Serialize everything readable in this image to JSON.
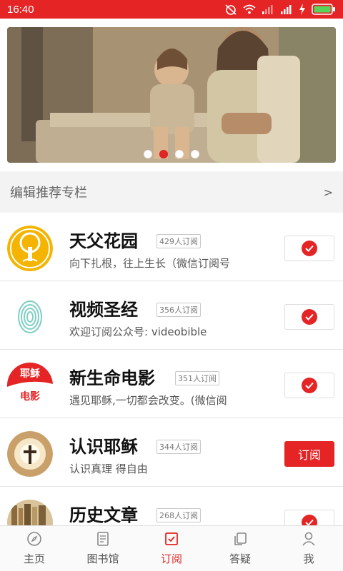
{
  "status_bar": {
    "time": "16:40",
    "icons": [
      "alarm-off-icon",
      "wifi-icon",
      "signal-weak-icon",
      "signal-icon",
      "charging-icon",
      "battery-icon"
    ]
  },
  "banner": {
    "image": "jesus-with-child-photo",
    "dots": 4,
    "active_dot": 1
  },
  "section": {
    "title": "编辑推荐专栏",
    "arrow": ">"
  },
  "items": [
    {
      "name": "天父花园",
      "count": "429人订阅",
      "desc": "向下扎根，往上生长（微信订阅号",
      "subscribed": true,
      "icon": "tree-logo"
    },
    {
      "name": "视频圣经",
      "count": "356人订阅",
      "desc": "欢迎订阅公众号: videobible",
      "subscribed": true,
      "icon": "fingerprint-logo"
    },
    {
      "name": "新生命电影",
      "count": "351人订阅",
      "desc": "遇见耶稣,一切都会改变。(微信阅",
      "subscribed": true,
      "icon": "movie-logo",
      "logo_text": [
        "耶稣",
        "电影"
      ]
    },
    {
      "name": "认识耶稣",
      "count": "344人订阅",
      "desc": "认识真理 得自由",
      "subscribed": false,
      "button_label": "订阅",
      "icon": "cross-logo"
    },
    {
      "name": "历史文章",
      "count": "268人订阅",
      "desc": "",
      "subscribed": true,
      "icon": "bookshelf-logo"
    }
  ],
  "tabs": [
    {
      "label": "主页",
      "icon": "compass-icon"
    },
    {
      "label": "图书馆",
      "icon": "book-icon"
    },
    {
      "label": "订阅",
      "icon": "subscribe-check-icon",
      "active": true
    },
    {
      "label": "答疑",
      "icon": "copy-icon"
    },
    {
      "label": "我",
      "icon": "person-icon"
    }
  ],
  "colors": {
    "accent": "#e52425",
    "background": "#ffffff",
    "section_bg": "#f3f3f3"
  }
}
